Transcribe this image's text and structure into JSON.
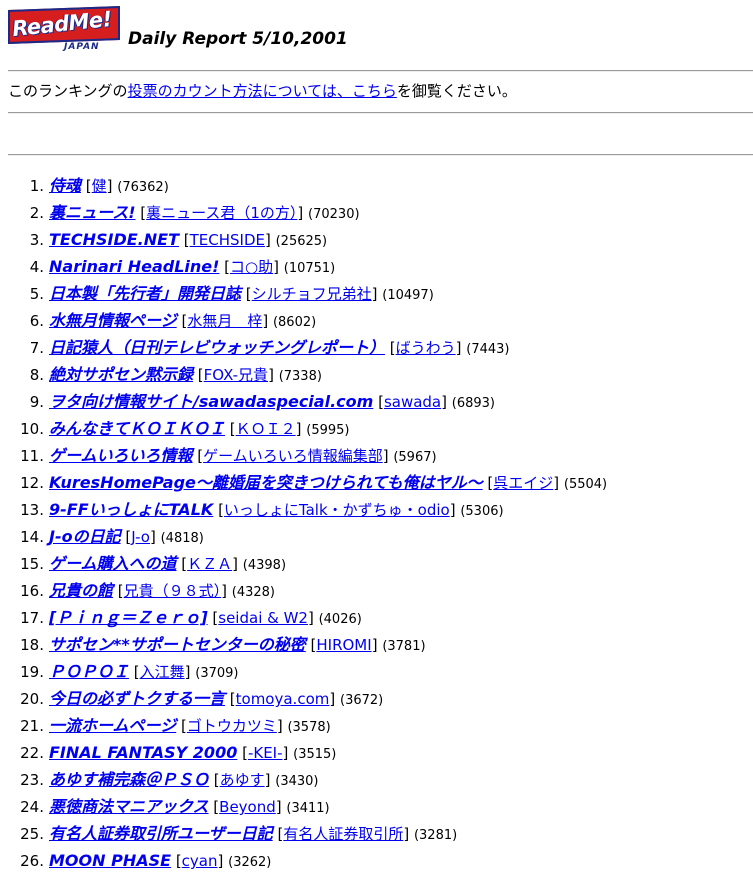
{
  "header": {
    "logo_text": "ReadMe!",
    "logo_sub": "JAPAN",
    "title": "Daily Report 5/10,2001"
  },
  "notice": {
    "prefix": "このランキングの",
    "link": "投票のカウント方法については、こちら",
    "suffix": "を御覧ください。"
  },
  "ranking": [
    {
      "rank": "1.",
      "site": "侍魂",
      "author": "健",
      "votes": "(76362)"
    },
    {
      "rank": "2.",
      "site": "裏ニュース!",
      "author": "裏ニュース君（1の方）",
      "votes": "(70230)"
    },
    {
      "rank": "3.",
      "site": "TECHSIDE.NET",
      "author": "TECHSIDE",
      "votes": "(25625)"
    },
    {
      "rank": "4.",
      "site": "Narinari HeadLine!",
      "author": "コ○助",
      "votes": "(10751)"
    },
    {
      "rank": "5.",
      "site": "日本製「先行者」開発日誌",
      "author": "シルチョフ兄弟社",
      "votes": "(10497)"
    },
    {
      "rank": "6.",
      "site": "水無月情報ページ",
      "author": "水無月　梓",
      "votes": "(8602)"
    },
    {
      "rank": "7.",
      "site": "日記猿人（日刊テレビウォッチングレポート）",
      "author": "ばうわう",
      "votes": "(7443)"
    },
    {
      "rank": "8.",
      "site": "絶対サポセン黙示録",
      "author": "FOX-兄貴",
      "votes": "(7338)"
    },
    {
      "rank": "9.",
      "site": "ヲタ向け情報サイト/sawadaspecial.com",
      "author": "sawada",
      "votes": "(6893)"
    },
    {
      "rank": "10.",
      "site": "みんなきてＫＯＩＫＯＩ",
      "author": "ＫＯＩ２",
      "votes": "(5995)"
    },
    {
      "rank": "11.",
      "site": "ゲームいろいろ情報",
      "author": "ゲームいろいろ情報編集部",
      "votes": "(5967)"
    },
    {
      "rank": "12.",
      "site": "KuresHomePage～離婚届を突きつけられても俺はヤル～",
      "author": "呉エイジ",
      "votes": "(5504)"
    },
    {
      "rank": "13.",
      "site": "9-FFいっしょにTALK",
      "author": "いっしょにTalk・かずちゅ・odio",
      "votes": "(5306)"
    },
    {
      "rank": "14.",
      "site": "J-oの日記",
      "author": "J-o",
      "votes": "(4818)"
    },
    {
      "rank": "15.",
      "site": "ゲーム購入への道",
      "author": "ＫＺＡ",
      "votes": "(4398)"
    },
    {
      "rank": "16.",
      "site": "兄貴の館",
      "author": "兄貴（９８式）",
      "votes": "(4328)"
    },
    {
      "rank": "17.",
      "site": "[Ｐｉｎｇ＝Ｚｅｒｏ]",
      "author": "seidai & W2",
      "votes": "(4026)"
    },
    {
      "rank": "18.",
      "site": "サポセン**サポートセンターの秘密",
      "author": "HIROMI",
      "votes": "(3781)"
    },
    {
      "rank": "19.",
      "site": "ＰＯＰＯＩ",
      "author": "入江舞",
      "votes": "(3709)"
    },
    {
      "rank": "20.",
      "site": "今日の必ずトクする一言",
      "author": "tomoya.com",
      "votes": "(3672)"
    },
    {
      "rank": "21.",
      "site": "一流ホームページ",
      "author": "ゴトウカツミ",
      "votes": "(3578)"
    },
    {
      "rank": "22.",
      "site": "FINAL FANTASY 2000",
      "author": "-KEI-",
      "votes": "(3515)"
    },
    {
      "rank": "23.",
      "site": "あゆす補完森＠ＰＳＯ",
      "author": "あゆす",
      "votes": "(3430)"
    },
    {
      "rank": "24.",
      "site": "悪徳商法マニアックス",
      "author": "Beyond",
      "votes": "(3411)"
    },
    {
      "rank": "25.",
      "site": "有名人証券取引所ユーザー日記",
      "author": "有名人証券取引所",
      "votes": "(3281)"
    },
    {
      "rank": "26.",
      "site": "MOON PHASE",
      "author": "cyan",
      "votes": "(3262)"
    }
  ]
}
